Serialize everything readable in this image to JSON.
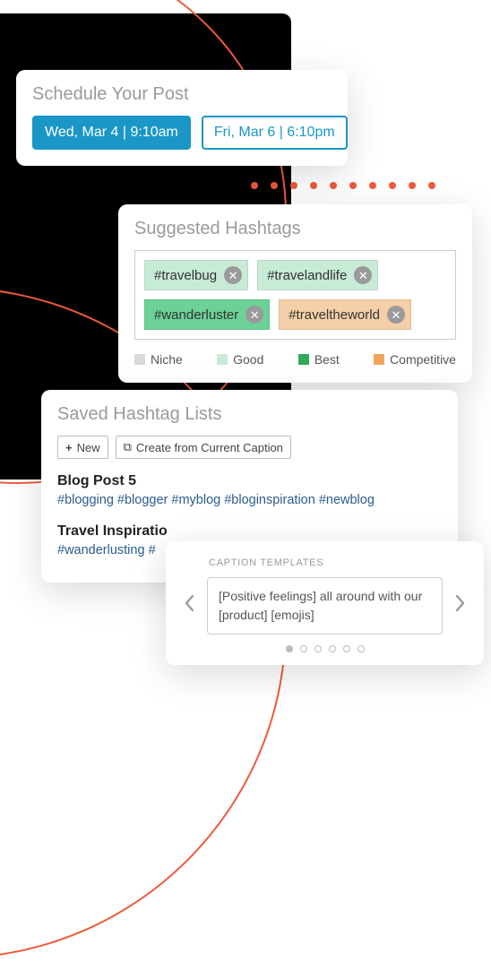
{
  "schedule": {
    "title": "Schedule Your Post",
    "options": [
      {
        "label": "Wed, Mar 4 | 9:10am",
        "selected": true
      },
      {
        "label": "Fri, Mar 6 | 6:10pm",
        "selected": false
      }
    ]
  },
  "suggested": {
    "title": "Suggested Hashtags",
    "tags": [
      {
        "label": "#travelbug",
        "tier": "good"
      },
      {
        "label": "#travelandlife",
        "tier": "good"
      },
      {
        "label": "#wanderluster",
        "tier": "best"
      },
      {
        "label": "#traveltheworld",
        "tier": "competitive"
      }
    ],
    "legend": {
      "niche": "Niche",
      "good": "Good",
      "best": "Best",
      "competitive": "Competitive"
    }
  },
  "saved": {
    "title": "Saved Hashtag Lists",
    "new_label": "New",
    "create_label": "Create from Current Caption",
    "lists": [
      {
        "name": "Blog Post",
        "count": "5",
        "tags": "#blogging #blogger #myblog #bloginspiration #newblog"
      },
      {
        "name": "Travel Inspiratio",
        "count": "",
        "tags": "#wanderlusting #"
      }
    ]
  },
  "caption": {
    "title": "CAPTION TEMPLATES",
    "text": "[Positive feelings] all around with our [product] [emojis]",
    "page_index": 0,
    "page_count": 6
  }
}
